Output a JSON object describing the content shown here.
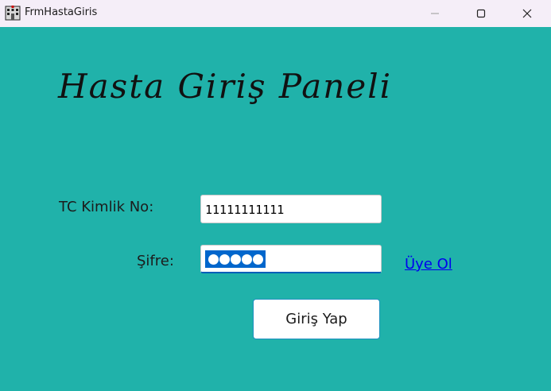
{
  "window": {
    "title": "FrmHastaGiris",
    "icons": {
      "app": "hospital-building-icon",
      "minimize": "minimize-icon",
      "maximize": "maximize-icon",
      "close": "close-icon"
    }
  },
  "form": {
    "heading": "Hasta Giriş Paneli",
    "tc_label": "TC Kimlik No:",
    "tc_value": "11111111111",
    "password_label": "Şifre:",
    "password_masked_length": 5,
    "register_link": "Üye Ol",
    "login_button": "Giriş Yap"
  },
  "colors": {
    "background": "#20b2aa",
    "selection": "#0066cc",
    "link": "#0000ee",
    "focus_border": "#005fb8"
  }
}
